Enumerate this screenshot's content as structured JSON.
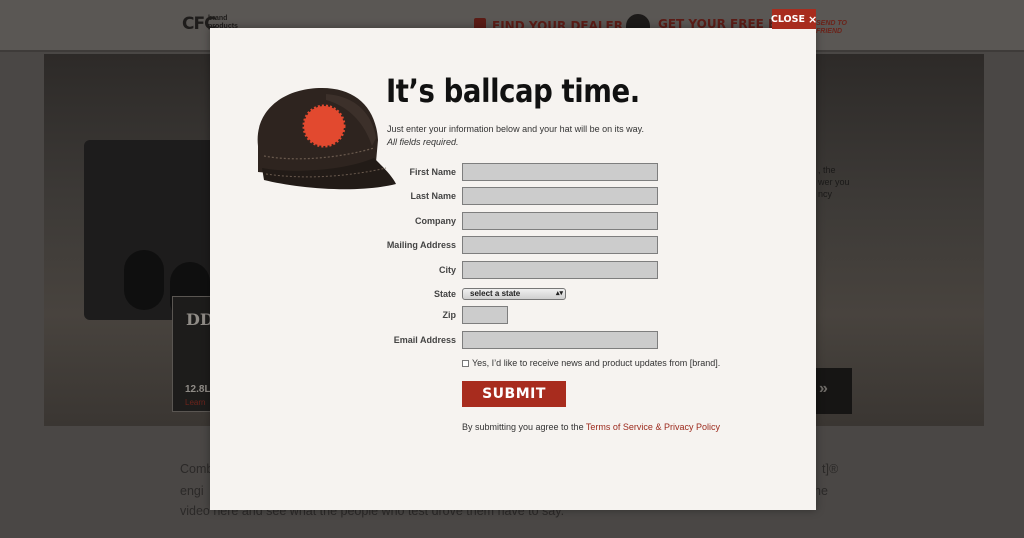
{
  "background": {
    "logo": "CFC",
    "logo_sub": "brand\nproducts",
    "nav_dealer": "FIND YOUR DEALER",
    "nav_ballcap": "GET YOUR FREE BALL",
    "send_friend": "SEND TO\nFRIEND",
    "panel_title": "DD",
    "panel_num": "12.8L",
    "panel_link": "Learn",
    "right_text": [
      ", the",
      "wer you",
      "ncy"
    ],
    "body_line1": "Comb",
    "body_line2": "engi",
    "body_line3": "video here and see what the people who test drove them have to say.",
    "body_right1": "t]®",
    "body_right2": "he",
    "arrow": "»"
  },
  "modal": {
    "close_label": "CLOSE",
    "close_icon": "×",
    "headline": "It’s ballcap time.",
    "intro": "Just enter your information below and your hat will be on its way.",
    "required_note": "All fields required.",
    "fields": {
      "first_name": {
        "label": "First Name",
        "value": ""
      },
      "last_name": {
        "label": "Last Name",
        "value": ""
      },
      "company": {
        "label": "Company",
        "value": ""
      },
      "mailing_address": {
        "label": "Mailing Address",
        "value": ""
      },
      "city": {
        "label": "City",
        "value": ""
      },
      "state": {
        "label": "State",
        "selected": "select a state"
      },
      "zip": {
        "label": "Zip",
        "value": ""
      },
      "email": {
        "label": "Email Address",
        "value": ""
      }
    },
    "newsletter_label": "Yes, I’d like to receive news and product updates from [brand].",
    "submit_label": "SUBMIT",
    "terms_prefix": "By submitting you agree to the ",
    "terms_link": "Terms of Service & Privacy Policy"
  },
  "colors": {
    "accent": "#a82c1e",
    "field_bg": "#cccccc",
    "modal_bg": "#f6f3f0"
  }
}
